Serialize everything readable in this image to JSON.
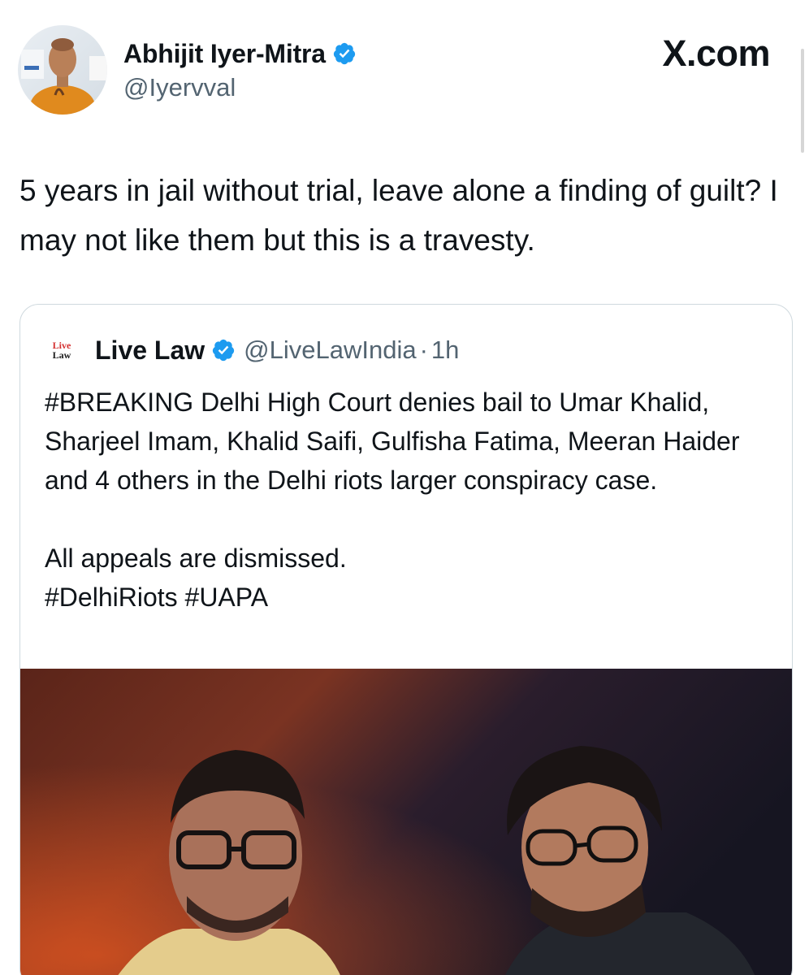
{
  "tweet": {
    "author": {
      "name": "Abhijit Iyer-Mitra",
      "handle": "@Iyervval",
      "verified": true
    },
    "site": "X.com",
    "text": "5 years in jail without trial, leave alone a finding of guilt? I may not like them but this is a travesty."
  },
  "quoted": {
    "logo_top": "Live",
    "logo_bottom": "Law",
    "name": "Live Law",
    "handle": "@LiveLawIndia",
    "separator": "·",
    "time": "1h",
    "text": "#BREAKING Delhi High Court denies bail to Umar Khalid, Sharjeel Imam, Khalid Saifi, Gulfisha Fatima, Meeran Haider and 4 others in the Delhi riots larger conspiracy case.\n\nAll appeals are dismissed.\n#DelhiRiots #UAPA"
  },
  "colors": {
    "verified_blue": "#1d9bf0",
    "text_primary": "#0f1419",
    "text_secondary": "#536471",
    "border": "#cfd9de"
  },
  "icons": {
    "verified": "verified-badge-icon"
  }
}
